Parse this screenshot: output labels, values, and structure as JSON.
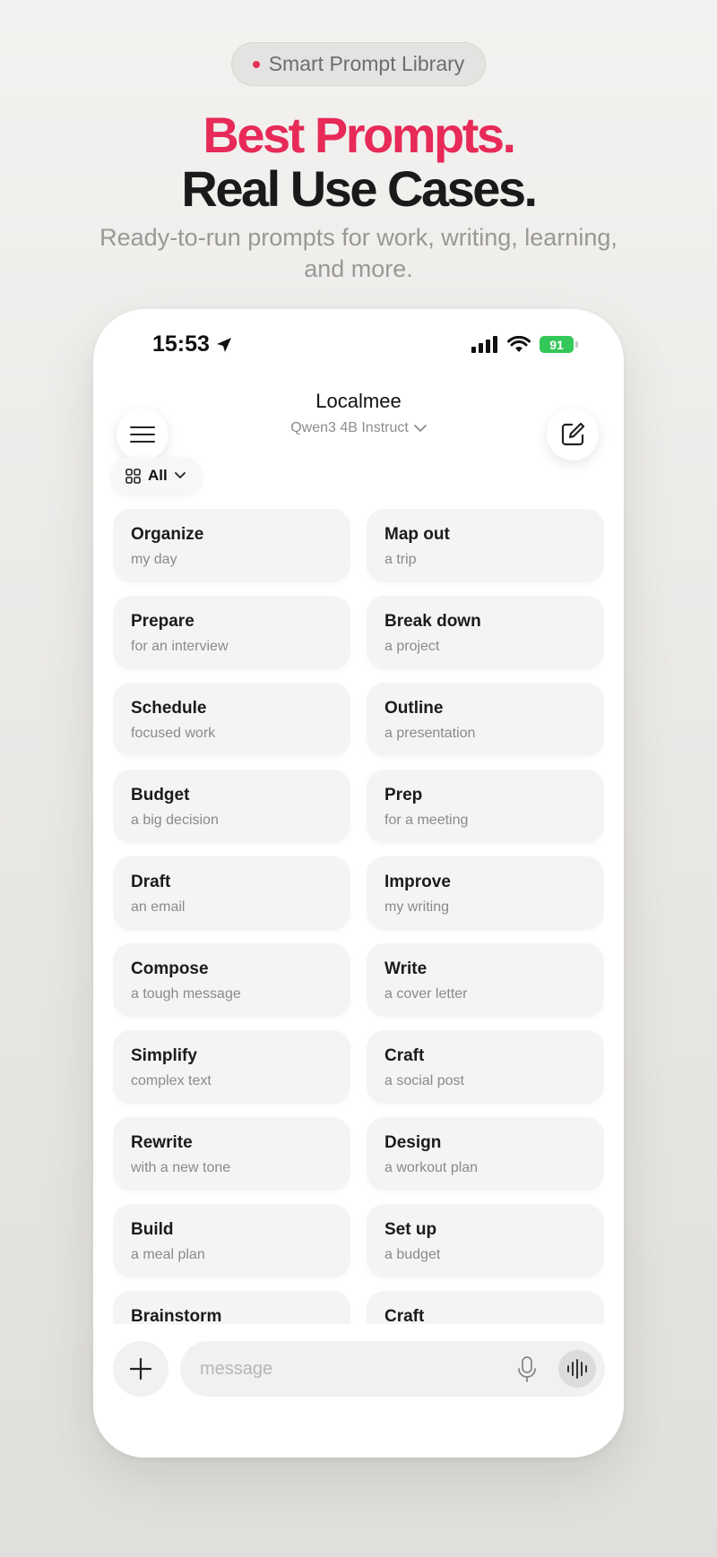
{
  "promo": {
    "pill_label": "Smart Prompt Library",
    "headline_line1": "Best Prompts.",
    "headline_line2": "Real Use Cases.",
    "subline": "Ready-to-run prompts for work, writing, learning, and more."
  },
  "status_bar": {
    "time": "15:53",
    "battery": "91",
    "icons": [
      "location-arrow-icon",
      "signal-icon",
      "wifi-icon",
      "battery-icon"
    ]
  },
  "header": {
    "title": "Localmee",
    "model": "Qwen3 4B Instruct",
    "menu_icon": "hamburger-icon",
    "edit_icon": "compose-icon"
  },
  "filter": {
    "label": "All",
    "icon": "grid-icon"
  },
  "prompts": [
    {
      "title": "Organize",
      "subtitle": "my day"
    },
    {
      "title": "Map out",
      "subtitle": "a trip"
    },
    {
      "title": "Prepare",
      "subtitle": "for an interview"
    },
    {
      "title": "Break down",
      "subtitle": "a project"
    },
    {
      "title": "Schedule",
      "subtitle": "focused work"
    },
    {
      "title": "Outline",
      "subtitle": "a presentation"
    },
    {
      "title": "Budget",
      "subtitle": "a big decision"
    },
    {
      "title": "Prep",
      "subtitle": "for a meeting"
    },
    {
      "title": "Draft",
      "subtitle": "an email"
    },
    {
      "title": "Improve",
      "subtitle": "my writing"
    },
    {
      "title": "Compose",
      "subtitle": "a tough message"
    },
    {
      "title": "Write",
      "subtitle": "a cover letter"
    },
    {
      "title": "Simplify",
      "subtitle": "complex text"
    },
    {
      "title": "Craft",
      "subtitle": "a social post"
    },
    {
      "title": "Rewrite",
      "subtitle": "with a new tone"
    },
    {
      "title": "Design",
      "subtitle": "a workout plan"
    },
    {
      "title": "Build",
      "subtitle": "a meal plan"
    },
    {
      "title": "Set up",
      "subtitle": "a budget"
    },
    {
      "title": "Brainstorm",
      "subtitle": ""
    },
    {
      "title": "Craft",
      "subtitle": ""
    }
  ],
  "composer": {
    "placeholder": "message",
    "icons": [
      "plus-icon",
      "microphone-icon",
      "voice-waveform-icon"
    ]
  },
  "colors": {
    "accent": "#e72a58",
    "battery": "#34c759"
  }
}
